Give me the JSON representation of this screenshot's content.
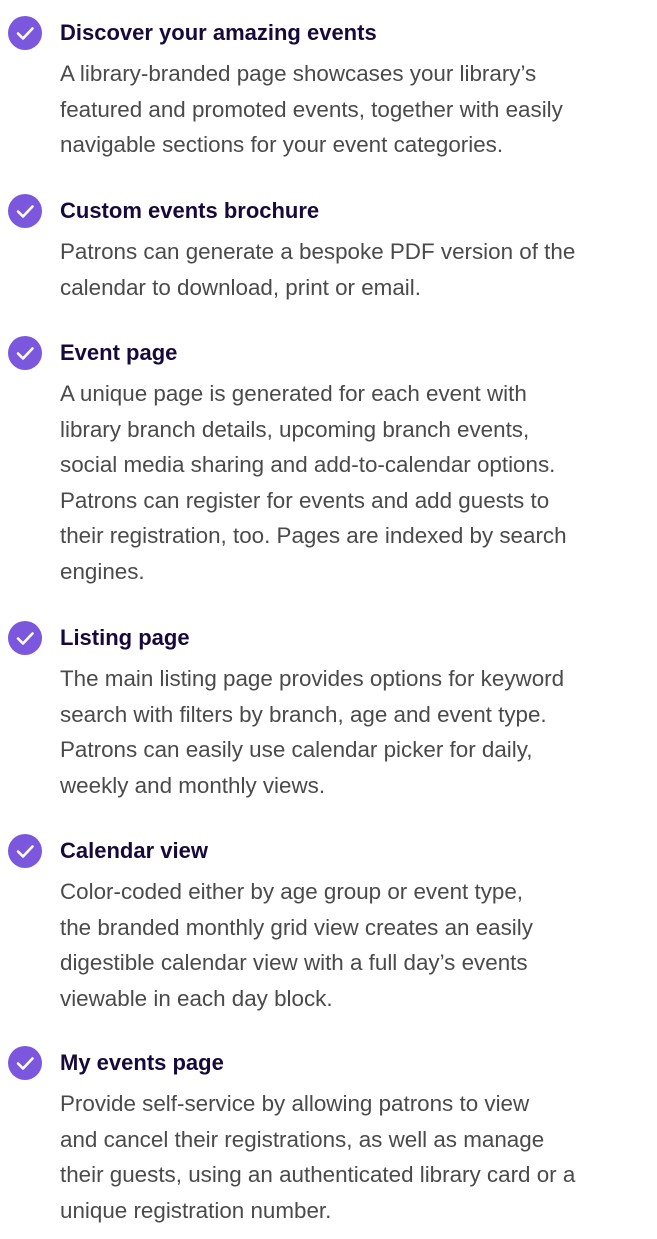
{
  "features": [
    {
      "title": "Discover your amazing events",
      "lines": [
        "A library-branded page showcases your library’s",
        "featured and promoted events, together with easily",
        "navigable sections for your event categories."
      ]
    },
    {
      "title": "Custom events brochure",
      "lines": [
        "Patrons can generate a bespoke PDF version of the",
        "calendar to download, print or email."
      ]
    },
    {
      "title": "Event page",
      "lines": [
        "A unique page is generated for each event with",
        "library branch details, upcoming branch events,",
        "social media sharing and add-to-calendar options.",
        "Patrons can register for events and add guests to",
        "their registration, too. Pages are indexed by search",
        "engines."
      ]
    },
    {
      "title": "Listing page",
      "lines": [
        "The main listing page provides options for keyword",
        "search with filters by branch, age and event type.",
        "Patrons can easily use calendar picker for daily,",
        "weekly and monthly views."
      ]
    },
    {
      "title": "Calendar view",
      "lines": [
        "Color-coded either by age group or event type,",
        "the branded monthly grid view creates an easily",
        "digestible calendar view with a full day’s events",
        "viewable in each day block."
      ]
    },
    {
      "title": "My events page",
      "lines": [
        "Provide self-service by allowing patrons to view",
        "and cancel their registrations, as well as manage",
        "their guests, using an authenticated library card or a",
        "unique registration number."
      ]
    }
  ],
  "icons": {
    "check": "check-circle-icon"
  },
  "colors": {
    "accent": "#7a57dd",
    "heading": "#160a3a",
    "body": "#4a4a4a"
  }
}
